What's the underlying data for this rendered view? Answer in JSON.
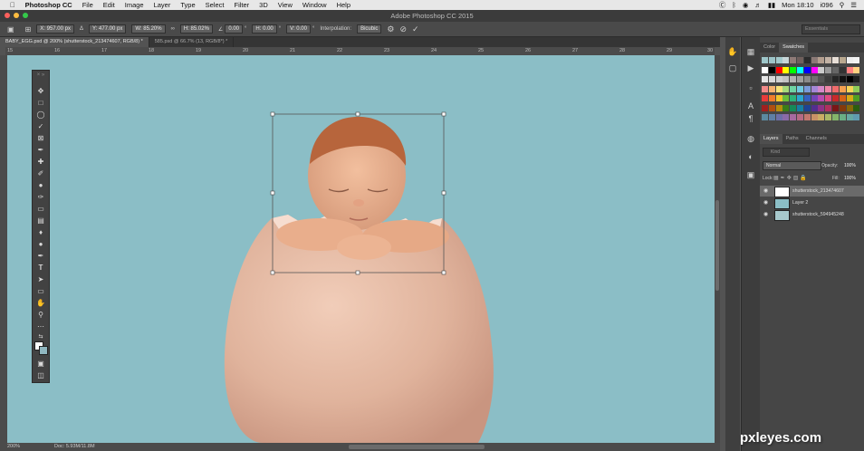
{
  "menubar": {
    "app": "Photoshop CC",
    "items": [
      "File",
      "Edit",
      "Image",
      "Layer",
      "Type",
      "Select",
      "Filter",
      "3D",
      "View",
      "Window",
      "Help"
    ],
    "clock": "Mon 18:10",
    "user": "i096"
  },
  "window": {
    "title": "Adobe Photoshop CC 2015"
  },
  "options": {
    "x": "X: 957.00 px",
    "y": "Y: 477.00 px",
    "w": "W: 85.20%",
    "h": "H: 85.02%",
    "angle": "0.00",
    "hskew": "H: 0.00",
    "vskew": "V: 0.00",
    "interp_label": "Interpolation:",
    "interp_value": "Bicubic",
    "workspace": "Essentials"
  },
  "tabs": [
    {
      "label": "BABY_EGG.psd @ 200% (shutterstock_213474607, RGB/8) *"
    },
    {
      "label": "585.psd @ 66.7% (13, RGB/8*) *"
    }
  ],
  "ruler": [
    "15",
    "16",
    "17",
    "18",
    "19",
    "20",
    "21",
    "22",
    "23",
    "24",
    "25",
    "26",
    "27",
    "28",
    "29",
    "30"
  ],
  "status": {
    "zoom": "200%",
    "doc": "Doc: 5.93M/11.8M"
  },
  "panels": {
    "color_tabs": [
      "Color",
      "Swatches"
    ],
    "layer_tabs": [
      "Layers",
      "Paths",
      "Channels"
    ],
    "kind": "Kind",
    "blend": "Normal",
    "opacity_label": "Opacity:",
    "opacity": "100%",
    "lock_label": "Lock:",
    "fill_label": "Fill:",
    "fill": "100%",
    "layers": [
      {
        "name": "shutterstock_213474607"
      },
      {
        "name": "Layer 2"
      },
      {
        "name": "shutterstock_594945248"
      }
    ]
  },
  "watermark": "pxleyes.com",
  "colors": {
    "canvas": "#8bbec6",
    "egg": "#e4b9a3",
    "panel": "#464646"
  }
}
